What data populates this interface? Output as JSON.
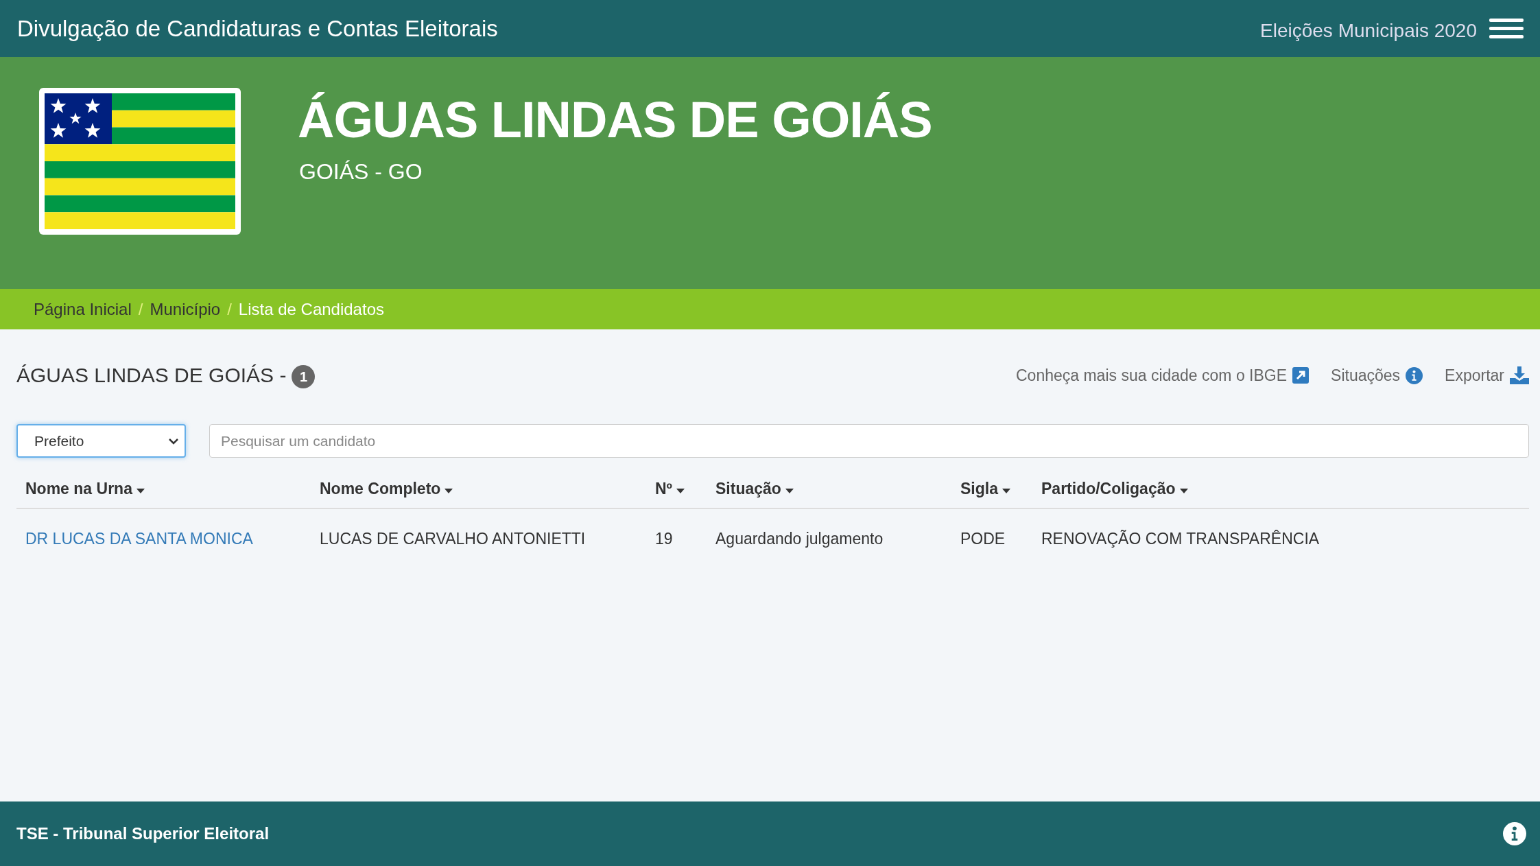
{
  "top_bar": {
    "title": "Divulgação de Candidaturas e Contas Eleitorais",
    "election": "Eleições Municipais 2020"
  },
  "header": {
    "city": "ÁGUAS LINDAS DE GOIÁS",
    "state": "GOIÁS - GO"
  },
  "breadcrumb": [
    {
      "label": "Página Inicial",
      "current": false
    },
    {
      "separator": "/",
      "label": "Município",
      "current": false
    },
    {
      "separator": "/",
      "label": "Lista de Candidatos",
      "current": true
    }
  ],
  "page_title": {
    "text": "ÁGUAS LINDAS DE GOIÁS -",
    "count": "1"
  },
  "links": [
    {
      "kind": "external",
      "label": "Conheça mais sua cidade com o IBGE"
    },
    {
      "kind": "info",
      "label": "Situações"
    },
    {
      "kind": "download",
      "label": "Exportar"
    }
  ],
  "office_select": {
    "value": "Prefeito"
  },
  "search": {
    "placeholder": "Pesquisar um candidato"
  },
  "table": {
    "columns": [
      "Nome na Urna",
      "Nome Completo",
      "Nº",
      "Situação",
      "Sigla",
      "Partido/Coligação"
    ],
    "rows": [
      [
        "DR LUCAS DA SANTA MONICA",
        "LUCAS DE CARVALHO ANTONIETTI",
        "19",
        "Aguardando julgamento",
        "PODE",
        "RENOVAÇÃO COM TRANSPARÊNCIA"
      ]
    ]
  },
  "footer": {
    "text": "TSE - Tribunal Superior Eleitoral"
  }
}
